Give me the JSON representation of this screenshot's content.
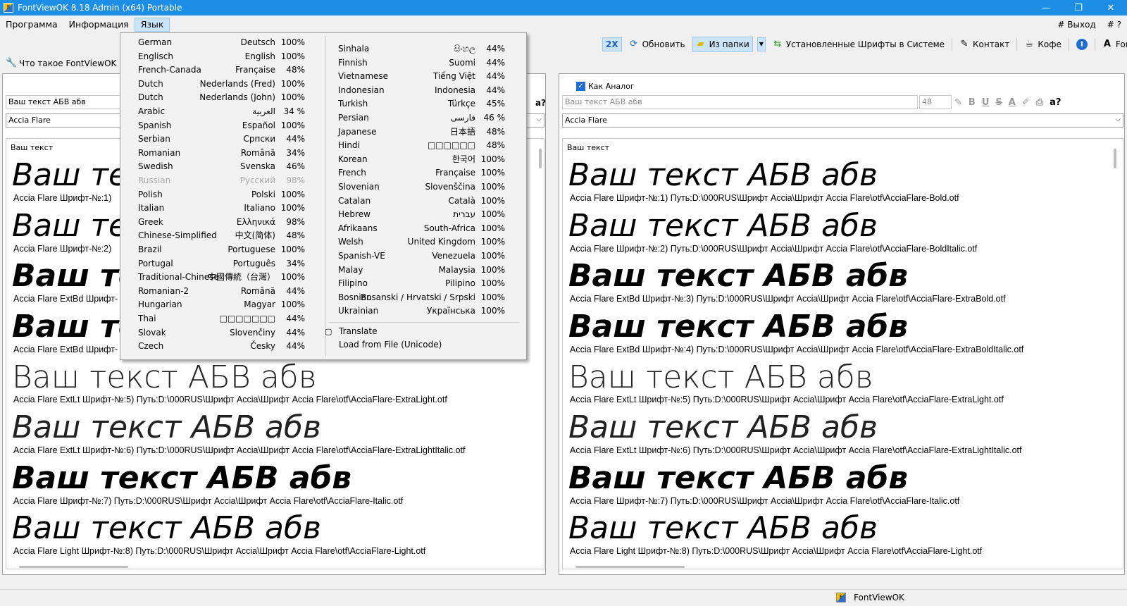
{
  "window": {
    "title": "FontViewOK 8.18 Admin (x64) Portable",
    "minimize": "—",
    "maximize": "❐",
    "close": "✕"
  },
  "menu": {
    "items": [
      "Программа",
      "Информация",
      "Язык"
    ],
    "exit": "# Выход",
    "help": "# ?"
  },
  "toolbar": {
    "twox": "2X",
    "refresh": "Обновить",
    "from_folder": "Из папки",
    "installed": "Установленные Шрифты в Системе",
    "contact": "Контакт",
    "coffee": "Кофе",
    "info": "i",
    "font_reader": "Font Reader"
  },
  "toolbar2": {
    "what_is": "Что такое FontViewOK"
  },
  "left_panel": {
    "text_value": "Ваш текст АБВ абв",
    "font_value": "Accia Flare",
    "help_q": "a?",
    "preview_header": "Ваш текст",
    "sample_text": "Ваш текст АБВ абв",
    "sample_clipped": "Ваш те",
    "rows": [
      {
        "caption": "Accia Flare Шрифт-№:1)"
      },
      {
        "caption": "Accia Flare Шрифт-№:2)"
      },
      {
        "caption": "Accia Flare ExtBd Шрифт-"
      },
      {
        "caption": "Accia Flare ExtBd Шрифт-"
      },
      {
        "caption": "Accia Flare ExtLt Шрифт-№:5) Путь:D:\\000RUS\\Шрифт Accia\\Шрифт Accia Flare\\otf\\AcciaFlare-ExtraLight.otf"
      },
      {
        "caption": "Accia Flare ExtLt Шрифт-№:6) Путь:D:\\000RUS\\Шрифт Accia\\Шрифт Accia Flare\\otf\\AcciaFlare-ExtraLightItalic.otf"
      },
      {
        "caption": "Accia Flare Шрифт-№:7) Путь:D:\\000RUS\\Шрифт Accia\\Шрифт Accia Flare\\otf\\AcciaFlare-Italic.otf"
      },
      {
        "caption": "Accia Flare Light Шрифт-№:8) Путь:D:\\000RUS\\Шрифт Accia\\Шрифт Accia Flare\\otf\\AcciaFlare-Light.otf"
      }
    ]
  },
  "right_panel": {
    "analog_label": "Как Аналог",
    "text_placeholder": "Ваш текст АБВ абв",
    "size_value": "48",
    "help_q": "a?",
    "font_value": "Accia Flare",
    "preview_header": "Ваш текст",
    "sample_text": "Ваш текст АБВ абв",
    "rows": [
      {
        "caption": "Accia Flare Шрифт-№:1) Путь:D:\\000RUS\\Шрифт Accia\\Шрифт Accia Flare\\otf\\AcciaFlare-Bold.otf"
      },
      {
        "caption": "Accia Flare Шрифт-№:2) Путь:D:\\000RUS\\Шрифт Accia\\Шрифт Accia Flare\\otf\\AcciaFlare-BoldItalic.otf"
      },
      {
        "caption": "Accia Flare ExtBd Шрифт-№:3) Путь:D:\\000RUS\\Шрифт Accia\\Шрифт Accia Flare\\otf\\AcciaFlare-ExtraBold.otf"
      },
      {
        "caption": "Accia Flare ExtBd Шрифт-№:4) Путь:D:\\000RUS\\Шрифт Accia\\Шрифт Accia Flare\\otf\\AcciaFlare-ExtraBoldItalic.otf"
      },
      {
        "caption": "Accia Flare ExtLt Шрифт-№:5) Путь:D:\\000RUS\\Шрифт Accia\\Шрифт Accia Flare\\otf\\AcciaFlare-ExtraLight.otf"
      },
      {
        "caption": "Accia Flare ExtLt Шрифт-№:6) Путь:D:\\000RUS\\Шрифт Accia\\Шрифт Accia Flare\\otf\\AcciaFlare-ExtraLightItalic.otf"
      },
      {
        "caption": "Accia Flare Шрифт-№:7) Путь:D:\\000RUS\\Шрифт Accia\\Шрифт Accia Flare\\otf\\AcciaFlare-Italic.otf"
      },
      {
        "caption": "Accia Flare Light Шрифт-№:8) Путь:D:\\000RUS\\Шрифт Accia\\Шрифт Accia Flare\\otf\\AcciaFlare-Light.otf"
      }
    ]
  },
  "language_menu": {
    "left": [
      {
        "name": "German",
        "native": "Deutsch",
        "pct": "100%"
      },
      {
        "name": "Englisch",
        "native": "English",
        "pct": "100%"
      },
      {
        "name": "French-Canada",
        "native": "Française",
        "pct": "48%"
      },
      {
        "name": "Dutch",
        "native": "Nederlands (Fred)",
        "pct": "100%"
      },
      {
        "name": "Dutch",
        "native": "Nederlands (John)",
        "pct": "100%"
      },
      {
        "name": "Arabic",
        "native": "العربية",
        "pct": "34 %"
      },
      {
        "name": "Spanish",
        "native": "Español",
        "pct": "100%"
      },
      {
        "name": "Serbian",
        "native": "Српски",
        "pct": "44%"
      },
      {
        "name": "Romanian",
        "native": "Română",
        "pct": "34%"
      },
      {
        "name": "Swedish",
        "native": "Svenska",
        "pct": "46%"
      },
      {
        "name": "Russian",
        "native": "Русский",
        "pct": "98%",
        "disabled": true
      },
      {
        "name": "Polish",
        "native": "Polski",
        "pct": "100%"
      },
      {
        "name": "Italian",
        "native": "Italiano",
        "pct": "100%"
      },
      {
        "name": "Greek",
        "native": "Ελληνικά",
        "pct": "98%"
      },
      {
        "name": "Chinese-Simplified",
        "native": "中文(简体)",
        "pct": "48%"
      },
      {
        "name": "Brazil",
        "native": "Portuguese",
        "pct": "100%"
      },
      {
        "name": "Portugal",
        "native": "Português",
        "pct": "34%"
      },
      {
        "name": "Traditional-Chinese",
        "native": "中國傳統（台灣）",
        "pct": "100%"
      },
      {
        "name": "Romanian-2",
        "native": "Română",
        "pct": "44%"
      },
      {
        "name": "Hungarian",
        "native": "Magyar",
        "pct": "100%"
      },
      {
        "name": "Thai",
        "native": "□□□□□□□",
        "pct": "44%"
      },
      {
        "name": "Slovak",
        "native": "Slovenčiny",
        "pct": "44%"
      },
      {
        "name": "Czech",
        "native": "Česky",
        "pct": "44%"
      }
    ],
    "right": [
      {
        "name": "Sinhala",
        "native": "සිංහල",
        "pct": "44%"
      },
      {
        "name": "Finnish",
        "native": "Suomi",
        "pct": "44%"
      },
      {
        "name": "Vietnamese",
        "native": "Tiếng Việt",
        "pct": "44%"
      },
      {
        "name": "Indonesian",
        "native": "Indonesia",
        "pct": "44%"
      },
      {
        "name": "Turkish",
        "native": "Türkçe",
        "pct": "45%"
      },
      {
        "name": "Persian",
        "native": "فارسی",
        "pct": "46 %"
      },
      {
        "name": "Japanese",
        "native": "日本語",
        "pct": "48%"
      },
      {
        "name": "Hindi",
        "native": "□□□□□□",
        "pct": "48%"
      },
      {
        "name": "Korean",
        "native": "한국어",
        "pct": "100%"
      },
      {
        "name": "French",
        "native": "Française",
        "pct": "100%"
      },
      {
        "name": "Slovenian",
        "native": "Slovenščina",
        "pct": "100%"
      },
      {
        "name": "Catalan",
        "native": "Català",
        "pct": "100%"
      },
      {
        "name": "Hebrew",
        "native": "עברית",
        "pct": "100%"
      },
      {
        "name": "Afrikaans",
        "native": "South-Africa",
        "pct": "100%"
      },
      {
        "name": "Welsh",
        "native": "United Kingdom",
        "pct": "100%"
      },
      {
        "name": "Spanish-VE",
        "native": "Venezuela",
        "pct": "100%"
      },
      {
        "name": "Malay",
        "native": "Malaysia",
        "pct": "100%"
      },
      {
        "name": "Filipino",
        "native": "Pilipino",
        "pct": "100%"
      },
      {
        "name": "Bosnian",
        "native": "Bosanski / Hrvatski / Srpski",
        "pct": "100%"
      },
      {
        "name": "Ukrainian",
        "native": "Українська",
        "pct": "100%"
      }
    ],
    "translate": "Translate",
    "load_file": "Load from File (Unicode)"
  },
  "status": {
    "app_name": "FontViewOK"
  }
}
